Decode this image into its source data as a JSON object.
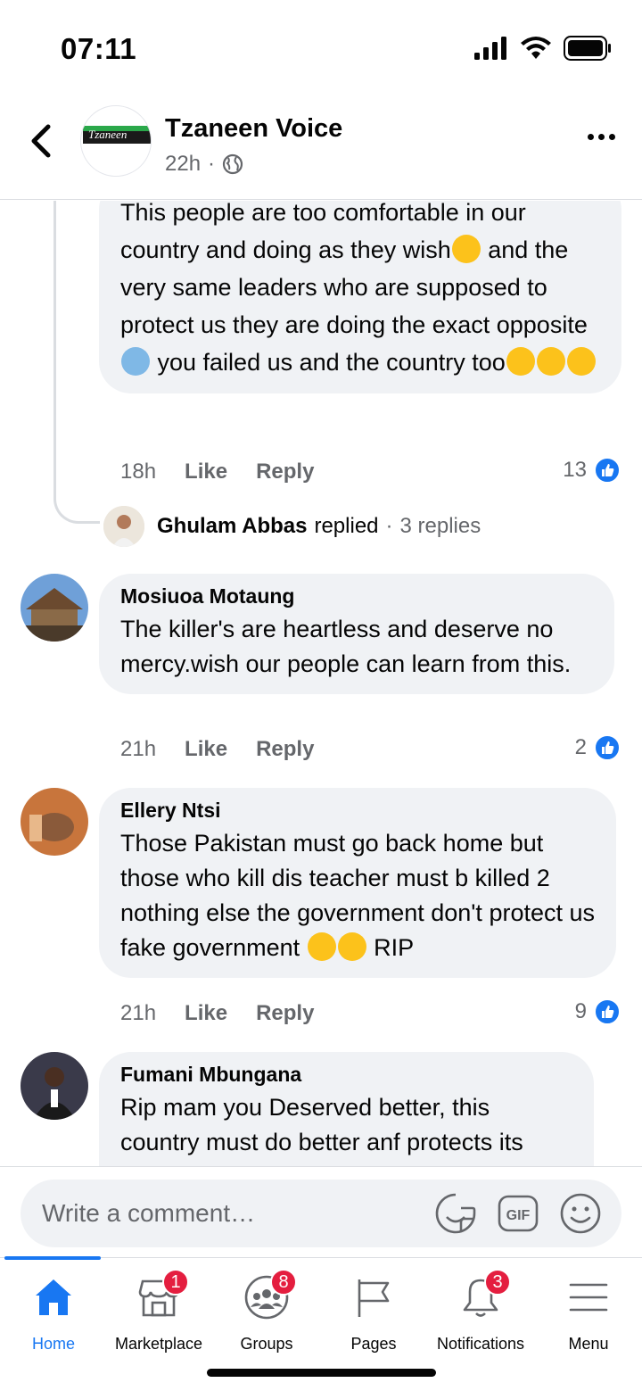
{
  "status_bar": {
    "time": "07:11"
  },
  "header": {
    "page_name": "Tzaneen Voice",
    "time_ago": "22h",
    "separator": "·",
    "logo_text": "Tzaneen"
  },
  "comments": [
    {
      "text_parts": [
        "This people are too comfortable in our country and doing as they wish",
        " and the very same leaders who are supposed to protect us they are doing the exact opposite ",
        " you failed us and the country too"
      ],
      "time": "18h",
      "like": "Like",
      "reply": "Reply",
      "reactions": "13"
    },
    {
      "author": "Mosiuoa Motaung",
      "text": "The killer's are heartless and deserve no mercy.wish our people can learn from this.",
      "time": "21h",
      "like": "Like",
      "reply": "Reply",
      "reactions": "2"
    },
    {
      "author": "Ellery Ntsi",
      "text_parts": [
        "Those Pakistan must go back home but those who kill dis teacher must b killed 2 nothing else the government don't protect us fake government ",
        " RIP"
      ],
      "time": "21h",
      "like": "Like",
      "reply": "Reply",
      "reactions": "9"
    },
    {
      "author": "Fumani Mbungana",
      "text": "Rip mam you Deserved better,  this country must do better anf protects its"
    }
  ],
  "replied_row": {
    "name": "Ghulam Abbas",
    "action": "replied",
    "separator": "·",
    "count": "3 replies"
  },
  "composer": {
    "placeholder": "Write a comment…",
    "gif_label": "GIF"
  },
  "tabs": [
    {
      "label": "Home",
      "icon": "home-icon",
      "active": true
    },
    {
      "label": "Marketplace",
      "icon": "marketplace-icon",
      "badge": "1"
    },
    {
      "label": "Groups",
      "icon": "groups-icon",
      "badge": "8"
    },
    {
      "label": "Pages",
      "icon": "pages-flag-icon"
    },
    {
      "label": "Notifications",
      "icon": "bell-icon",
      "badge": "3"
    },
    {
      "label": "Menu",
      "icon": "menu-icon"
    }
  ],
  "colors": {
    "accent": "#1877f2",
    "badge": "#e41e3f",
    "bubble": "#f0f2f5",
    "muted": "#65676b"
  }
}
